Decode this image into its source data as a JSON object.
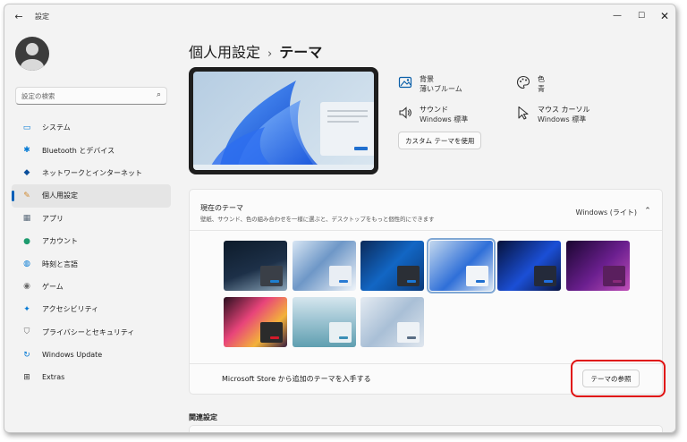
{
  "window": {
    "app_title": "設定",
    "back_glyph": "←",
    "min_glyph": "—",
    "max_glyph": "☐",
    "close_glyph": "✕"
  },
  "sidebar": {
    "search_placeholder": "設定の検索",
    "items": [
      {
        "label": "システム",
        "icon": "monitor-icon",
        "color": "#0078d4"
      },
      {
        "label": "Bluetooth とデバイス",
        "icon": "bluetooth-icon",
        "color": "#0078d4"
      },
      {
        "label": "ネットワークとインターネット",
        "icon": "wifi-icon",
        "color": "#0a4e9b"
      },
      {
        "label": "個人用設定",
        "icon": "brush-icon",
        "color": "#d08a30",
        "selected": true
      },
      {
        "label": "アプリ",
        "icon": "apps-icon",
        "color": "#5a6a7a"
      },
      {
        "label": "アカウント",
        "icon": "person-icon",
        "color": "#1d9b6e"
      },
      {
        "label": "時刻と言語",
        "icon": "globe-icon",
        "color": "#0078d4"
      },
      {
        "label": "ゲーム",
        "icon": "gamepad-icon",
        "color": "#6b6b6b"
      },
      {
        "label": "アクセシビリティ",
        "icon": "accessibility-icon",
        "color": "#0078d4"
      },
      {
        "label": "プライバシーとセキュリティ",
        "icon": "shield-icon",
        "color": "#6b6b6b"
      },
      {
        "label": "Windows Update",
        "icon": "update-icon",
        "color": "#0078d4"
      },
      {
        "label": "Extras",
        "icon": "extras-icon",
        "color": "#333333"
      }
    ]
  },
  "header": {
    "parent": "個人用設定",
    "separator": "›",
    "current": "テーマ"
  },
  "props": {
    "background": {
      "label": "背景",
      "value": "薄いブルーム"
    },
    "color": {
      "label": "色",
      "value": "青"
    },
    "sound": {
      "label": "サウンド",
      "value": "Windows 標準"
    },
    "cursor": {
      "label": "マウス カーソル",
      "value": "Windows 標準"
    },
    "custom_button": "カスタム テーマを使用"
  },
  "current_theme": {
    "title": "現在のテーマ",
    "description": "壁紙、サウンド、色の組み合わせを一様に選ぶと、デスクトップをもっと個性的にできます",
    "value": "Windows (ライト)",
    "chevron": "⌃",
    "themes": [
      {
        "name": "theme-earth",
        "bg": "linear-gradient(160deg,#0d1b2a 0%,#1d3048 55%,#8aa4b8 100%)",
        "win": "#3a3f47",
        "bar": "#1e7fd0"
      },
      {
        "name": "theme-architecture",
        "bg": "linear-gradient(135deg,#d8e6f4 0%,#6e97c7 45%,#f1f5f9 100%)",
        "win": "#e9eef4",
        "bar": "#2a7bd3"
      },
      {
        "name": "theme-windows-dark-logo",
        "bg": "linear-gradient(135deg,#0b2a5a 0%,#1266c4 50%,#0a3a7a 100%)",
        "win": "#2b2f36",
        "bar": "#1a78d6"
      },
      {
        "name": "theme-windows-light",
        "bg": "linear-gradient(135deg,#c5d9ee 0%,#2f6fd8 55%,#dce8f3 100%)",
        "win": "#f2f5f8",
        "bar": "#1f6fcf",
        "selected": true
      },
      {
        "name": "theme-windows-dark",
        "bg": "linear-gradient(135deg,#06123a 0%,#1b4fd6 55%,#0a1440 100%)",
        "win": "#242a3a",
        "bar": "#1f6fe0"
      },
      {
        "name": "theme-glow",
        "bg": "linear-gradient(135deg,#1a0630 0%,#6b1f8f 55%,#c04fb8 100%)",
        "win": "#5a1f5e",
        "bar": "#8a2a7a"
      },
      {
        "name": "theme-captured-motion",
        "bg": "linear-gradient(135deg,#2a0f1f 0%,#e8447a 40%,#f3b23a 70%,#3a2040 100%)",
        "win": "#2b2b2b",
        "bar": "#d11a2a"
      },
      {
        "name": "theme-flow",
        "bg": "linear-gradient(180deg,#d5e6ee 0%,#9fc5d3 45%,#5f9fb0 100%)",
        "win": "#e8f0f3",
        "bar": "#3a8fb6"
      },
      {
        "name": "theme-sunrise",
        "bg": "linear-gradient(135deg,#e4ebf2 0%,#a9bfd6 50%,#dfe6ee 100%)",
        "win": "#eef2f6",
        "bar": "#5a6e85"
      }
    ],
    "store_text": "Microsoft Store から追加のテーマを入手する",
    "browse_button": "テーマの参照"
  },
  "related": {
    "title": "関連設定"
  }
}
